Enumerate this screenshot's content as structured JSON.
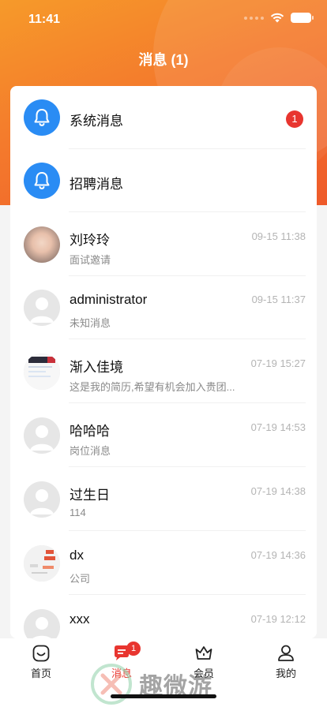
{
  "status_bar": {
    "time": "11:41"
  },
  "header": {
    "title": "消息 (1)"
  },
  "messages": [
    {
      "name": "系统消息",
      "badge": "1",
      "type": "system"
    },
    {
      "name": "招聘消息",
      "type": "system"
    },
    {
      "name": "刘玲玲",
      "preview": "面试邀请",
      "time": "09-15 11:38"
    },
    {
      "name": "administrator",
      "preview": "未知消息",
      "time": "09-15 11:37"
    },
    {
      "name": "渐入佳境",
      "preview": "这是我的简历,希望有机会加入贵团...",
      "time": "07-19 15:27"
    },
    {
      "name": "哈哈哈",
      "preview": "岗位消息",
      "time": "07-19 14:53"
    },
    {
      "name": "过生日",
      "preview": "114",
      "time": "07-19 14:38"
    },
    {
      "name": "dx",
      "preview": "公司",
      "time": "07-19 14:36"
    },
    {
      "name": "xxx",
      "preview": "",
      "time": "07-19 12:12"
    }
  ],
  "tabbar": {
    "home": "首页",
    "messages": "消息",
    "messages_badge": "1",
    "member": "会员",
    "mine": "我的"
  },
  "watermark": {
    "text": "趣微游"
  },
  "colors": {
    "accent": "#e8352f",
    "header_orange": "#f47a2c",
    "system_icon_blue": "#2a8cf4"
  }
}
